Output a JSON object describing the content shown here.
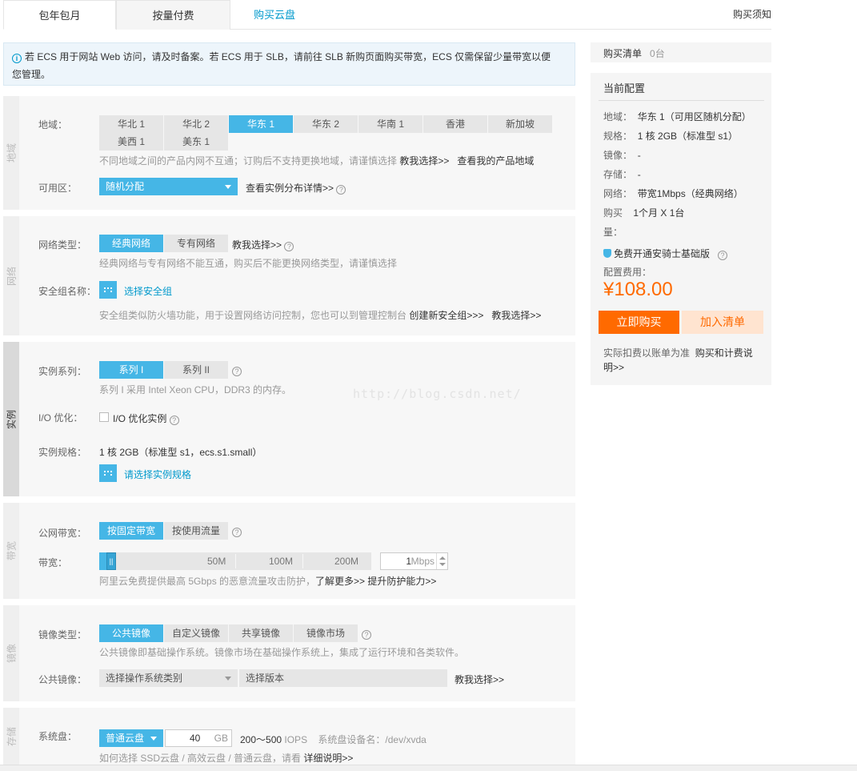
{
  "tabs": {
    "monthly": "包年包月",
    "pay_as_you_go": "按量付费",
    "buy_disk": "购买云盘",
    "buy_notice": "购买须知"
  },
  "notice": {
    "line1": "若 ECS 用于网站 Web 访问，请及时备案。若 ECS 用于 SLB，请前往 SLB 新购页面购买带宽，ECS 仅需保留少量带宽以便",
    "line2": "您管理。"
  },
  "region": {
    "side": "地域",
    "label": "地域：",
    "options": [
      "华北 1",
      "华北 2",
      "华东 1",
      "华东 2",
      "华南 1",
      "香港",
      "新加坡",
      "美西 1",
      "美东 1"
    ],
    "selected": "华东 1",
    "hint": "不同地域之间的产品内网不互通；订购后不支持更换地域，请谨慎选择",
    "help_link": "教我选择>>",
    "my_regions_link": "查看我的产品地域",
    "zone_label": "可用区：",
    "zone_value": "随机分配",
    "zone_link": "查看实例分布详情>>"
  },
  "network": {
    "side": "网络",
    "type_label": "网络类型：",
    "options": [
      "经典网络",
      "专有网络"
    ],
    "selected": "经典网络",
    "help_link": "教我选择>>",
    "hint": "经典网络与专有网络不能互通，购买后不能更换网络类型，请谨慎选择",
    "sg_label": "安全组名称：",
    "sg_button": "选择安全组",
    "sg_hint": "安全组类似防火墙功能，用于设置网络访问控制，您也可以到管理控制台",
    "sg_create_link": "创建新安全组>>>",
    "sg_help_link": "教我选择>>"
  },
  "instance": {
    "side": "实例",
    "series_label": "实例系列：",
    "series_options": [
      "系列 I",
      "系列 II"
    ],
    "series_selected": "系列 I",
    "series_hint": "系列 I 采用 Intel Xeon CPU，DDR3 的内存。",
    "io_label": "I/O 优化：",
    "io_checkbox_label": "I/O 优化实例",
    "spec_label": "实例规格：",
    "spec_value": "1 核 2GB（标准型 s1，ecs.s1.small）",
    "spec_button": "请选择实例规格"
  },
  "bandwidth": {
    "side": "带宽",
    "type_label": "公网带宽：",
    "options": [
      "按固定带宽",
      "按使用流量"
    ],
    "selected": "按固定带宽",
    "bw_label": "带宽：",
    "ticks": [
      "50M",
      "100M",
      "200M"
    ],
    "value": "1",
    "unit": "Mbps",
    "level_fraction": 0.01,
    "hint": "阿里云免费提供最高 5Gbps 的恶意流量攻击防护，",
    "more_link": "了解更多>>",
    "upgrade_link": "提升防护能力>>"
  },
  "image": {
    "side": "镜像",
    "type_label": "镜像类型：",
    "options": [
      "公共镜像",
      "自定义镜像",
      "共享镜像",
      "镜像市场"
    ],
    "selected": "公共镜像",
    "hint": "公共镜像即基础操作系统。镜像市场在基础操作系统上，集成了运行环境和各类软件。",
    "public_label": "公共镜像：",
    "os_select": "选择操作系统类别",
    "version_select": "选择版本",
    "help_link": "教我选择>>"
  },
  "storage": {
    "side": "存储",
    "sys_label": "系统盘：",
    "disk_type": "普通云盘",
    "size": "40",
    "unit": "GB",
    "iops_range": "200～500",
    "iops_unit": "IOPS",
    "device_label": "系统盘设备名：/dev/xvda",
    "hint": "如何选择 SSD云盘 / 高效云盘 / 普通云盘，请看",
    "detail_link": "详细说明>>"
  },
  "cart": {
    "title": "购买清单",
    "count": "0台"
  },
  "config": {
    "title": "当前配置",
    "rows": [
      {
        "k": "地域：",
        "v": "华东 1（可用区随机分配）"
      },
      {
        "k": "规格：",
        "v": "1 核 2GB（标准型 s1）"
      },
      {
        "k": "镜像：",
        "v": "-"
      },
      {
        "k": "存储：",
        "v": "-"
      },
      {
        "k": "网络：",
        "v": "带宽1Mbps（经典网络）"
      },
      {
        "k": "购买",
        "v": "1个月 X 1台"
      },
      {
        "k": "量：",
        "v": ""
      }
    ],
    "security_free": "免费开通安骑士基础版",
    "fee_label": "配置费用：",
    "price": "¥108.00",
    "buy_now": "立即购买",
    "add_cart": "加入清单",
    "footer_text": "实际扣费以账单为准",
    "footer_link1": "购买和计费说",
    "footer_link2": "明>>"
  },
  "watermark": "http://blog.csdn.net/",
  "colors": {
    "accent": "#45b6e6",
    "buy": "#ff6a00",
    "price": "#ff6a00"
  }
}
